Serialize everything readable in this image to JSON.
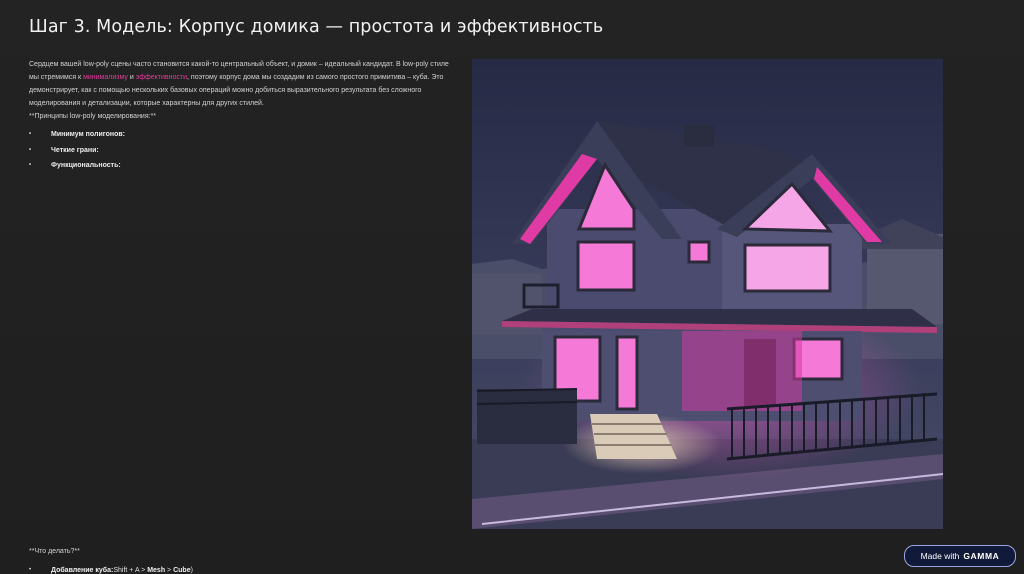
{
  "slide": {
    "title": "Шаг 3. Модель: Корпус домика — простота и эффективность",
    "intro": {
      "before": "Сердцем вашей low-poly сцены часто становится какой-то центральный объект, и домик – идеальный кандидат. В low-poly стиле мы стремимся к ",
      "highlight1": "минимализму",
      "between": " и ",
      "highlight2": "эффективности",
      "after": ", поэтому корпус дома мы создадим из самого простого примитива – куба. Это демонстрирует, как с помощью нескольких базовых операций можно добиться выразительного результата без сложного моделирования и детализации, которые характерны для других стилей."
    },
    "principles_heading": "**Принципы low-poly моделирования:**",
    "principles": [
      {
        "bullet": "•",
        "label": "Минимум полигонов:"
      },
      {
        "bullet": "•",
        "label": "Четкие грани:"
      },
      {
        "bullet": "•",
        "label": "Функциональность:"
      }
    ],
    "what_todo": "**Что делать?**",
    "cut_item": {
      "bullet": "•",
      "bold_label": "Добавление куба:",
      "rest": "Shift + A > ",
      "mesh": "Mesh",
      "arrow": " > ",
      "cube": "Cube",
      "close": ")"
    }
  },
  "colors": {
    "highlight": "#e3389a",
    "window_glow": "#f57ad8",
    "background": "#232323"
  },
  "badge": {
    "made_with": "Made with",
    "brand": "GAMMA"
  }
}
